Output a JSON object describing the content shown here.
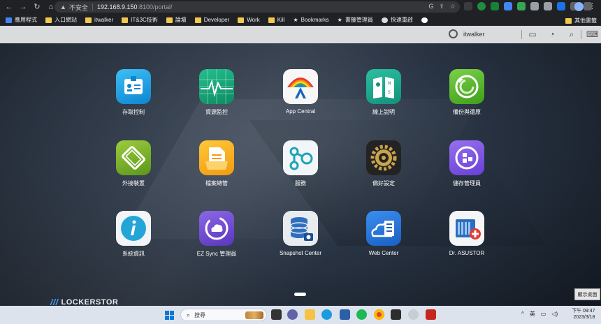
{
  "browser": {
    "security_label": "不安全",
    "url_host": "192.168.9.150",
    "url_path": ":8100/portal/",
    "bookmarks": [
      "應用程式",
      "入口網站",
      "itwalker",
      "IT&3C技術",
      "論壇",
      "Developer",
      "Work",
      "Kill",
      "Bookmarks",
      "書籤管理員",
      "快速重啟"
    ],
    "other_bookmarks": "其他書籤"
  },
  "portal": {
    "username": "itwalker"
  },
  "apps": [
    {
      "label": "存取控制",
      "icon": "id-badge-icon",
      "color": "#1e9be0"
    },
    {
      "label": "資源監控",
      "icon": "monitor-graph-icon",
      "color": "#1aa37a"
    },
    {
      "label": "App Central",
      "icon": "app-central-icon",
      "color": "#f4f4f4"
    },
    {
      "label": "線上說明",
      "icon": "help-map-icon",
      "color": "#1fa68e"
    },
    {
      "label": "備份與還原",
      "icon": "backup-restore-icon",
      "color": "#5dbb2e"
    },
    {
      "label": "外接裝置",
      "icon": "external-device-icon",
      "color": "#7bb22d"
    },
    {
      "label": "檔案總管",
      "icon": "file-explorer-icon",
      "color": "#f4a81d"
    },
    {
      "label": "服務",
      "icon": "services-icon",
      "color": "#f2f6f8"
    },
    {
      "label": "偏好設定",
      "icon": "settings-gear-icon",
      "color": "#232323"
    },
    {
      "label": "儲存管理員",
      "icon": "storage-manager-icon",
      "color": "#7b4fe0"
    },
    {
      "label": "系統資訊",
      "icon": "info-icon",
      "color": "#23a5d8"
    },
    {
      "label": "EZ Sync 管理員",
      "icon": "ez-sync-icon",
      "color": "#6a46c9"
    },
    {
      "label": "Snapshot Center",
      "icon": "snapshot-center-icon",
      "color": "#e8ecef"
    },
    {
      "label": "Web Center",
      "icon": "web-center-icon",
      "color": "#1f73d8"
    },
    {
      "label": "Dr. ASUSTOR",
      "icon": "dr-asustor-icon",
      "color": "#f3f5f7"
    }
  ],
  "brand": "LOCKERSTOR",
  "show_desktop": "顯示桌面",
  "taskbar": {
    "search_placeholder": "搜尋",
    "ime": "英",
    "time": "下午 09:47",
    "date": "2023/3/18"
  }
}
